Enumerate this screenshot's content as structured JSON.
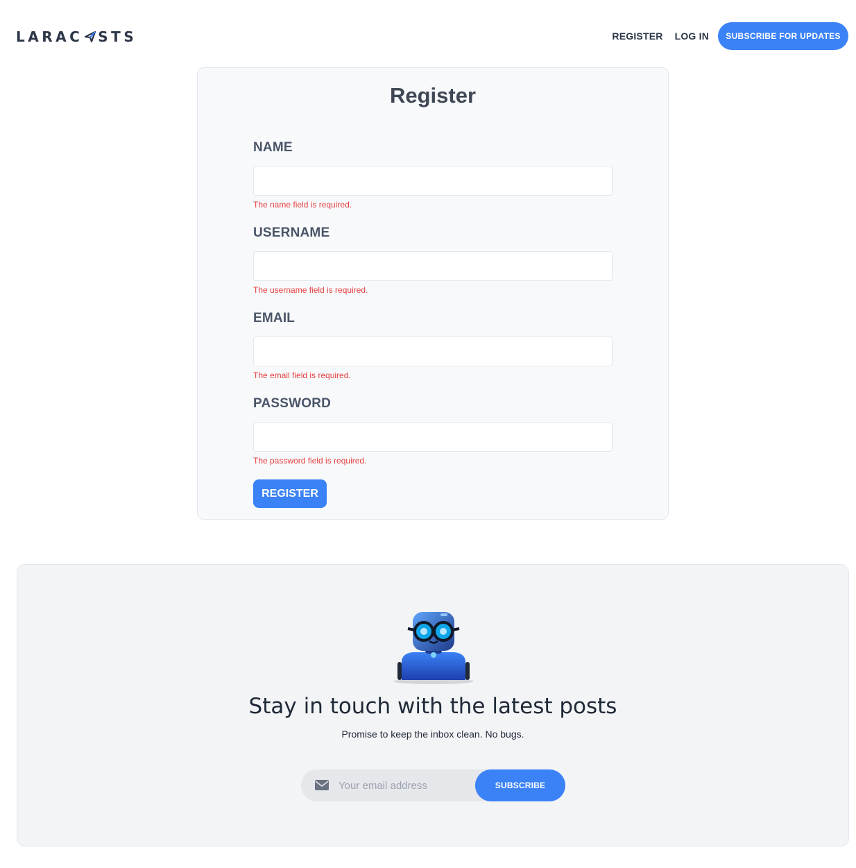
{
  "header": {
    "logo_left": "LARAC",
    "logo_right": "STS",
    "nav_register": "REGISTER",
    "nav_login": "LOG IN",
    "subscribe_button": "SUBSCRIBE FOR UPDATES"
  },
  "form": {
    "title": "Register",
    "fields": [
      {
        "label": "NAME",
        "value": "",
        "error": "The name field is required."
      },
      {
        "label": "USERNAME",
        "value": "",
        "error": "The username field is required."
      },
      {
        "label": "EMAIL",
        "value": "",
        "error": "The email field is required."
      },
      {
        "label": "PASSWORD",
        "value": "",
        "error": "The password field is required."
      }
    ],
    "submit_label": "REGISTER"
  },
  "newsletter": {
    "title": "Stay in touch with the latest posts",
    "subtitle": "Promise to keep the inbox clean. No bugs.",
    "email_placeholder": "Your email address",
    "subscribe_label": "SUBSCRIBE",
    "icon": "mail-icon",
    "illustration": "robot-mascot"
  },
  "colors": {
    "accent": "#3b82f6",
    "error": "#e53e3e",
    "heading": "#3f4754"
  }
}
